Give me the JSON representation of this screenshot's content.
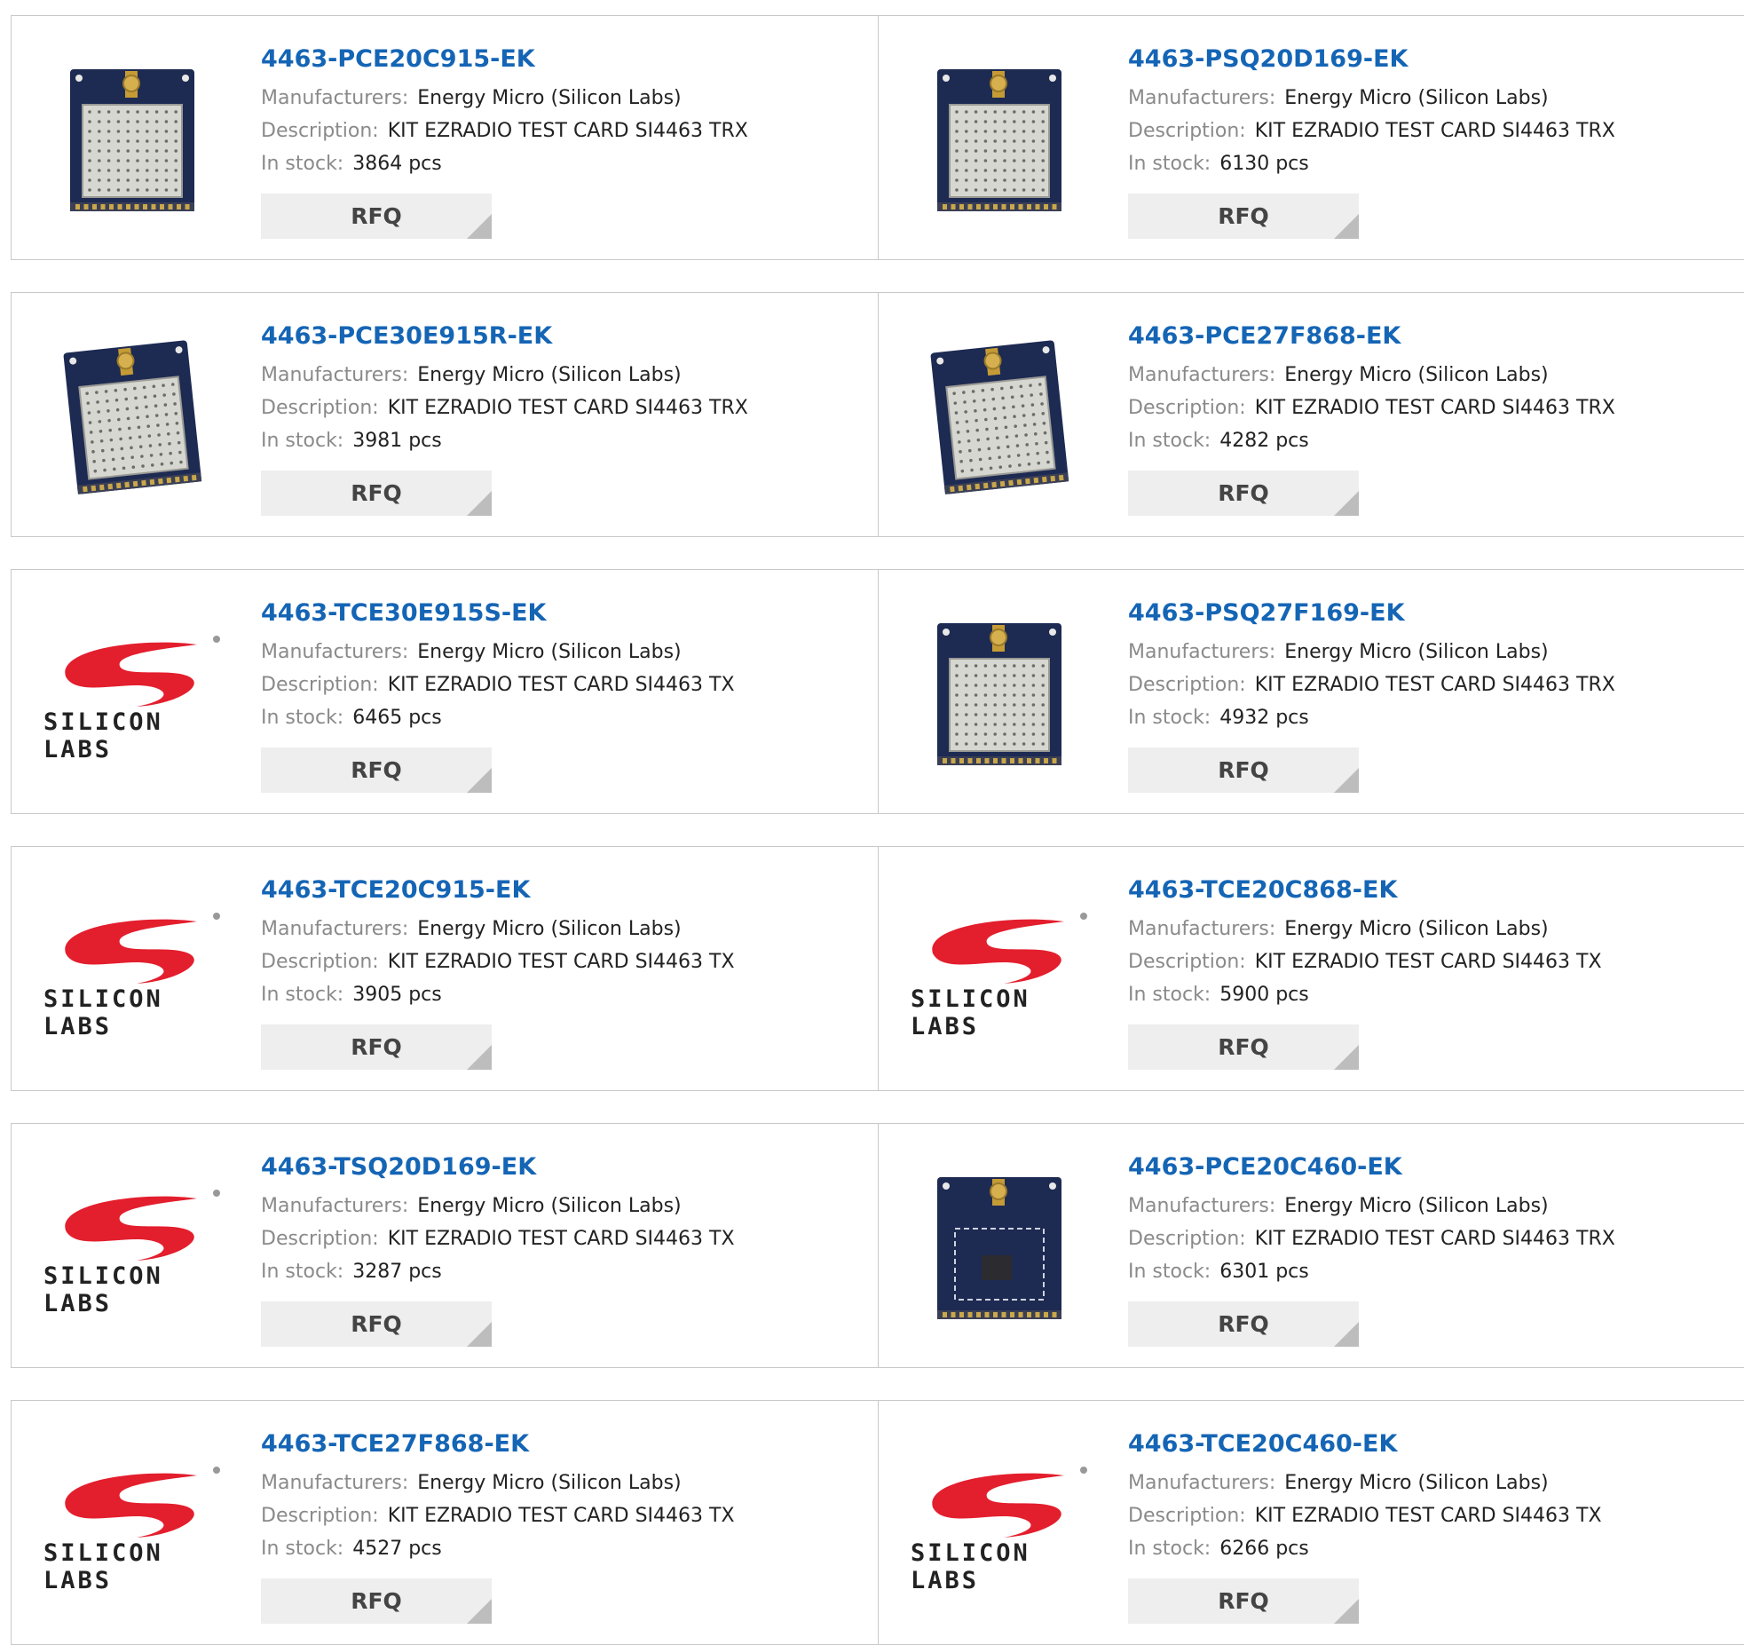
{
  "labels": {
    "manufacturers": "Manufacturers:",
    "description": "Description:",
    "in_stock": "In stock:",
    "rfq": "RFQ",
    "logo_text": "SILICON LABS"
  },
  "products": [
    {
      "part": "4463-PCE20C915-EK",
      "manufacturer": "Energy Micro (Silicon Labs)",
      "description": "KIT EZRADIO TEST CARD SI4463 TRX",
      "stock": "3864 pcs",
      "image": "board-antenna"
    },
    {
      "part": "4463-PSQ20D169-EK",
      "manufacturer": "Energy Micro (Silicon Labs)",
      "description": "KIT EZRADIO TEST CARD SI4463 TRX",
      "stock": "6130 pcs",
      "image": "board-antenna"
    },
    {
      "part": "4463-PCE30E915R-EK",
      "manufacturer": "Energy Micro (Silicon Labs)",
      "description": "KIT EZRADIO TEST CARD SI4463 TRX",
      "stock": "3981 pcs",
      "image": "board-tilted"
    },
    {
      "part": "4463-PCE27F868-EK",
      "manufacturer": "Energy Micro (Silicon Labs)",
      "description": "KIT EZRADIO TEST CARD SI4463 TRX",
      "stock": "4282 pcs",
      "image": "board-tilted"
    },
    {
      "part": "4463-TCE30E915S-EK",
      "manufacturer": "Energy Micro (Silicon Labs)",
      "description": "KIT EZRADIO TEST CARD SI4463 TX",
      "stock": "6465 pcs",
      "image": "silicon-labs-logo"
    },
    {
      "part": "4463-PSQ27F169-EK",
      "manufacturer": "Energy Micro (Silicon Labs)",
      "description": "KIT EZRADIO TEST CARD SI4463 TRX",
      "stock": "4932 pcs",
      "image": "board-antenna"
    },
    {
      "part": "4463-TCE20C915-EK",
      "manufacturer": "Energy Micro (Silicon Labs)",
      "description": "KIT EZRADIO TEST CARD SI4463 TX",
      "stock": "3905 pcs",
      "image": "silicon-labs-logo"
    },
    {
      "part": "4463-TCE20C868-EK",
      "manufacturer": "Energy Micro (Silicon Labs)",
      "description": "KIT EZRADIO TEST CARD SI4463 TX",
      "stock": "5900 pcs",
      "image": "silicon-labs-logo"
    },
    {
      "part": "4463-TSQ20D169-EK",
      "manufacturer": "Energy Micro (Silicon Labs)",
      "description": "KIT EZRADIO TEST CARD SI4463 TX",
      "stock": "3287 pcs",
      "image": "silicon-labs-logo"
    },
    {
      "part": "4463-PCE20C460-EK",
      "manufacturer": "Energy Micro (Silicon Labs)",
      "description": "KIT EZRADIO TEST CARD SI4463 TRX",
      "stock": "6301 pcs",
      "image": "board-bare"
    },
    {
      "part": "4463-TCE27F868-EK",
      "manufacturer": "Energy Micro (Silicon Labs)",
      "description": "KIT EZRADIO TEST CARD SI4463 TX",
      "stock": "4527 pcs",
      "image": "silicon-labs-logo"
    },
    {
      "part": "4463-TCE20C460-EK",
      "manufacturer": "Energy Micro (Silicon Labs)",
      "description": "KIT EZRADIO TEST CARD SI4463 TX",
      "stock": "6266 pcs",
      "image": "silicon-labs-logo"
    }
  ],
  "colors": {
    "link": "#1565b5",
    "label": "#8a8a8a",
    "value": "#222222",
    "button_bg": "#eeeeee",
    "border": "#c9c9c9",
    "logo_red": "#e31e2d",
    "board_blue": "#1d2a52"
  }
}
